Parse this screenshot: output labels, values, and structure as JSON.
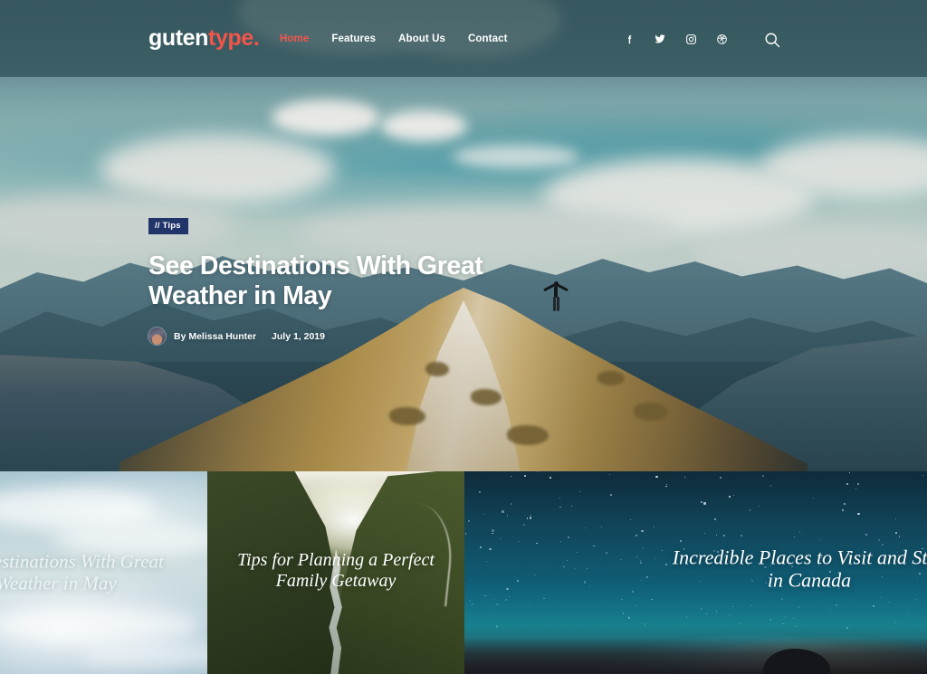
{
  "site": {
    "logo_first": "guten",
    "logo_second": "type.",
    "accent_color": "#f4554a",
    "header_bg": "#31545a"
  },
  "nav": {
    "items": [
      {
        "label": "Home",
        "active": true
      },
      {
        "label": "Features",
        "active": false
      },
      {
        "label": "About Us",
        "active": false
      },
      {
        "label": "Contact",
        "active": false
      }
    ]
  },
  "social": {
    "items": [
      {
        "name": "facebook-icon",
        "label": "Facebook"
      },
      {
        "name": "twitter-icon",
        "label": "Twitter"
      },
      {
        "name": "instagram-icon",
        "label": "Instagram"
      },
      {
        "name": "dribbble-icon",
        "label": "Dribbble"
      }
    ],
    "search_label": "Search"
  },
  "hero": {
    "category": "// Tips",
    "category_bg": "#21356b",
    "title": "See Destinations With Great Weather in May",
    "author": "By Melissa Hunter",
    "date": "July 1, 2019"
  },
  "cards": [
    {
      "title": "See Destinations With Great Weather in May",
      "scene": "pale-sky"
    },
    {
      "title": "Tips for Planning a Perfect Family Getaway",
      "scene": "green-valley"
    },
    {
      "title": "Incredible Places to Visit and Stay in Canada",
      "scene": "starry-night"
    }
  ]
}
